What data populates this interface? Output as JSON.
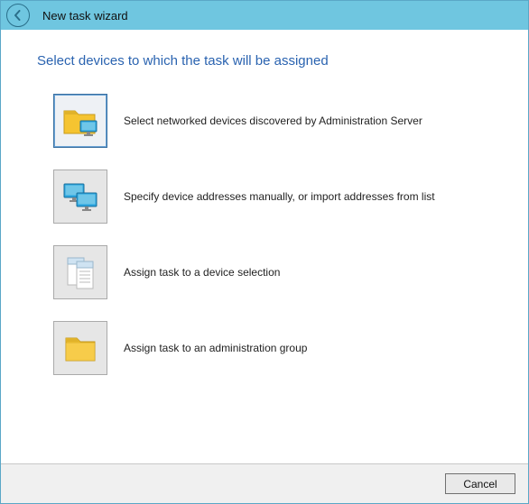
{
  "window": {
    "title": "New task wizard"
  },
  "heading": "Select devices to which the task will be assigned",
  "options": [
    {
      "label": "Select networked devices discovered by Administration Server"
    },
    {
      "label": "Specify device addresses manually, or import addresses from list"
    },
    {
      "label": "Assign task to a device selection"
    },
    {
      "label": "Assign task to an administration group"
    }
  ],
  "buttons": {
    "cancel": "Cancel"
  }
}
